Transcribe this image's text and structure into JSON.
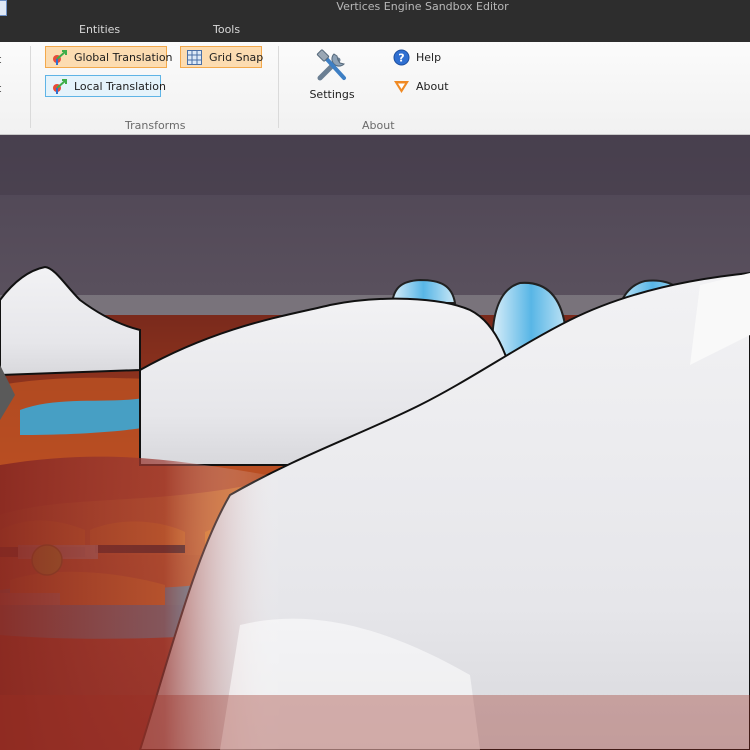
{
  "window": {
    "title": "Vertices Engine Sandbox Editor"
  },
  "ribbon_tabs": [
    {
      "label": "Entities"
    },
    {
      "label": "Tools"
    }
  ],
  "ribbon": {
    "left_stub_labels": [
      "t",
      "t"
    ],
    "transforms": {
      "group_label": "Transforms",
      "global_translation": {
        "label": "Global Translation",
        "state": "checked"
      },
      "local_translation": {
        "label": "Local Translation",
        "state": "focused"
      },
      "grid_snap": {
        "label": "Grid Snap",
        "state": "checked"
      }
    },
    "about": {
      "group_label": "About",
      "settings_label": "Settings",
      "help_label": "Help",
      "about_label": "About"
    }
  },
  "viewport": {
    "content": "3D sandbox scene"
  },
  "colors": {
    "titlebar_bg": "#2d2d2d",
    "ribbon_bg": "#f5f5f5",
    "checked_bg": "#fcdcb1",
    "checked_border": "#f3a94c",
    "focused_bg": "#e5f3fb",
    "focused_border": "#5fb4e6",
    "lava": "#a83a22",
    "snow": "#efefef",
    "sky": "#5c5260"
  }
}
